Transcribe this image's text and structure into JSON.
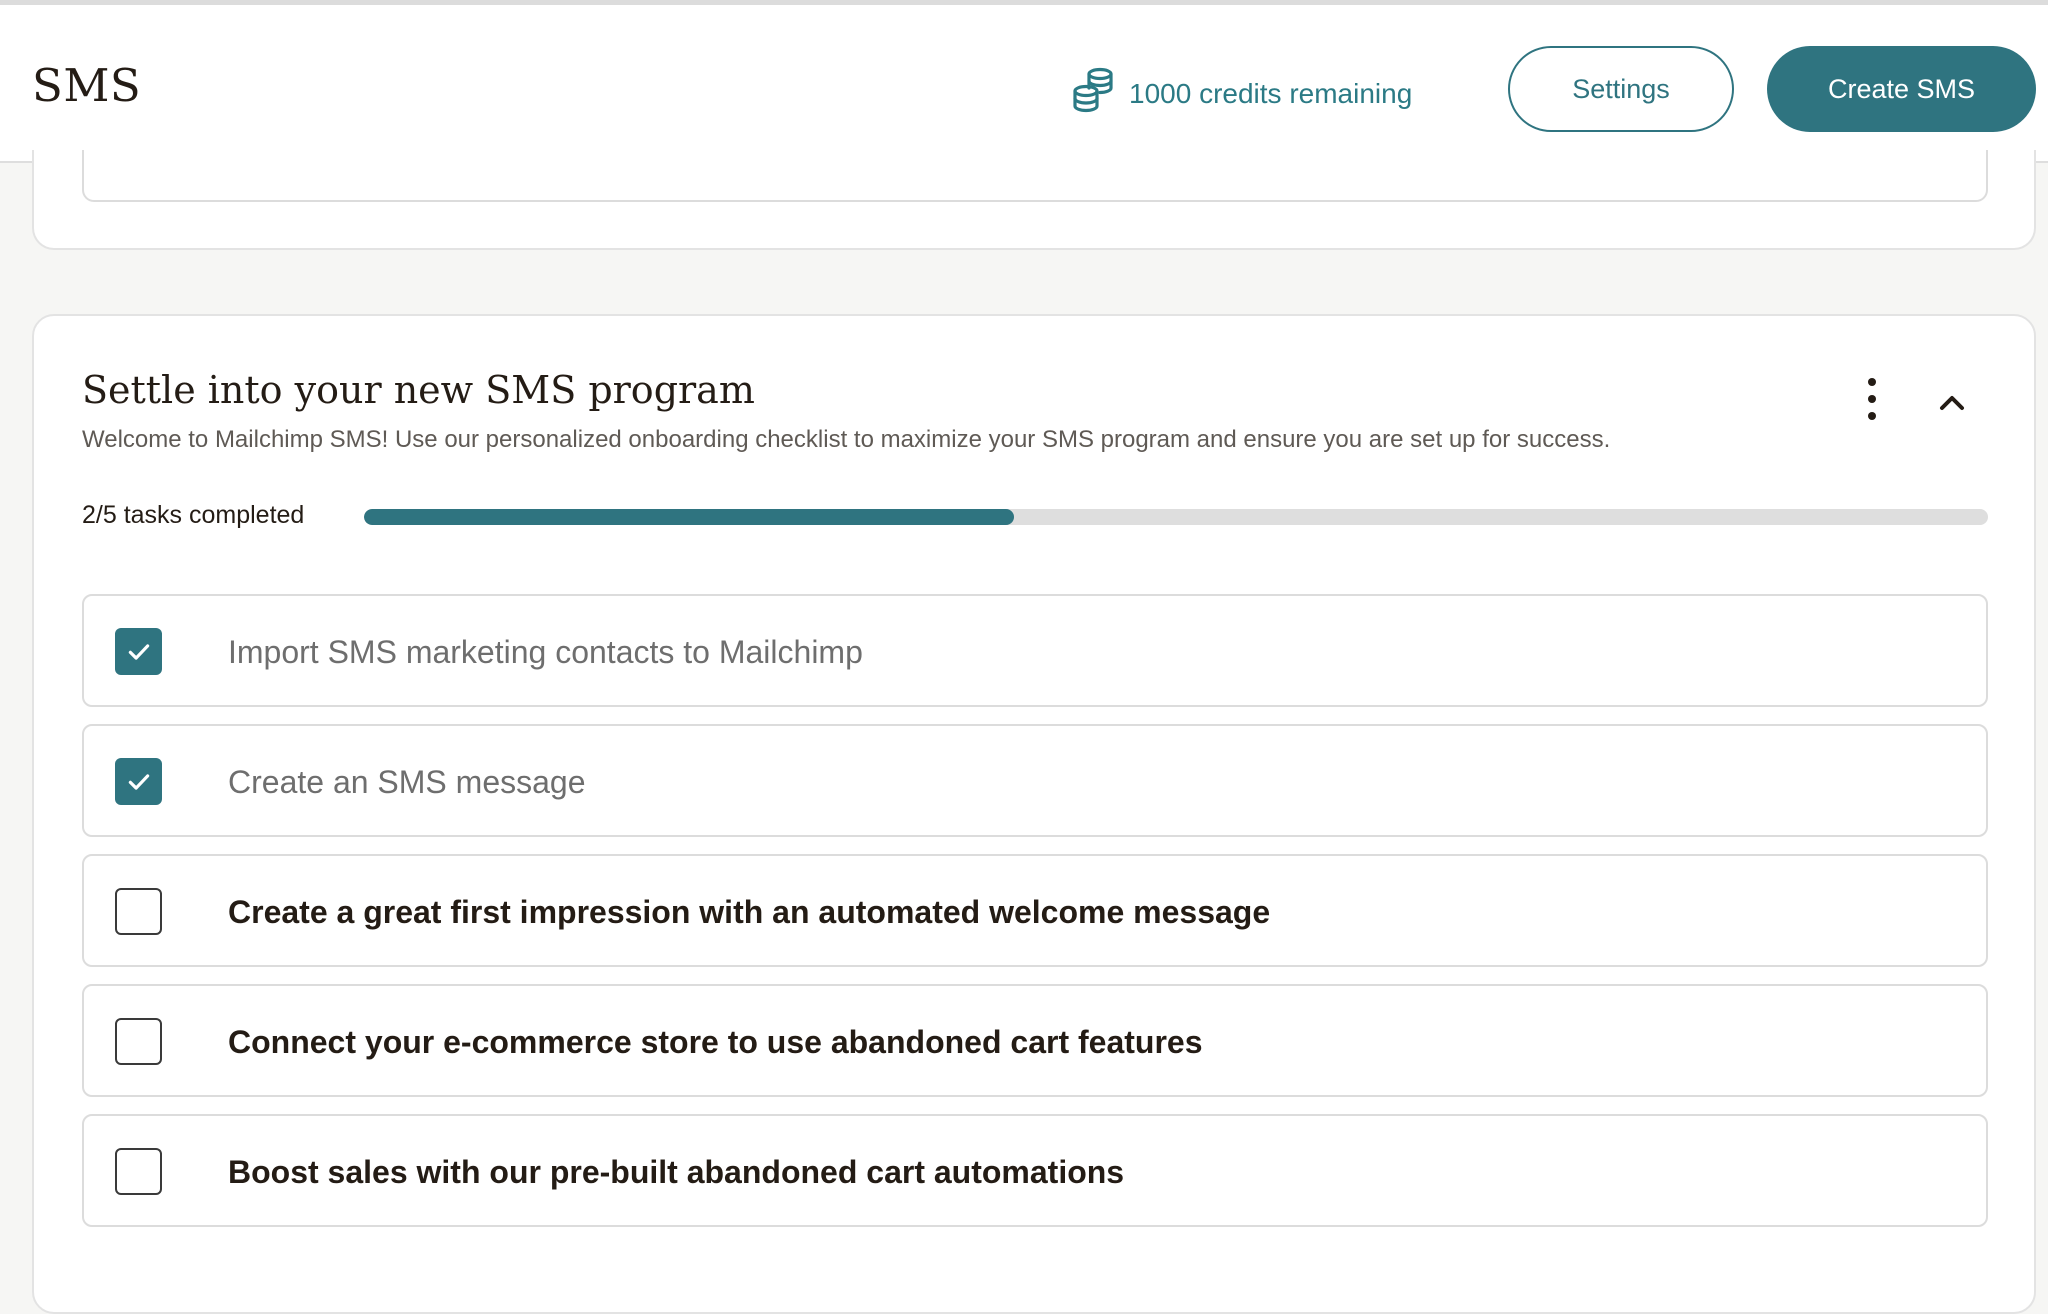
{
  "header": {
    "title": "SMS",
    "credits_text": "1000 credits remaining",
    "settings_label": "Settings",
    "create_label": "Create SMS"
  },
  "onboarding": {
    "title": "Settle into your new SMS program",
    "description": "Welcome to Mailchimp SMS! Use our personalized onboarding checklist to maximize your SMS program and ensure you are set up for success.",
    "progress_label": "2/5 tasks completed",
    "progress_fraction": 0.4,
    "tasks": [
      {
        "label": "Import SMS marketing contacts to Mailchimp",
        "completed": true
      },
      {
        "label": "Create an SMS message",
        "completed": true
      },
      {
        "label": "Create a great first impression with an automated welcome message",
        "completed": false
      },
      {
        "label": "Connect your e-commerce store to use abandoned cart features",
        "completed": false
      },
      {
        "label": "Boost sales with our pre-built abandoned cart automations",
        "completed": false
      }
    ]
  },
  "icons": {
    "credits": "coins-stack-icon",
    "more": "more-vertical-icon",
    "collapse": "chevron-up-icon",
    "check": "checkmark-icon"
  },
  "colors": {
    "accent": "#2f7480",
    "credits_text": "#2b7a85",
    "progress_track": "#dedede"
  }
}
